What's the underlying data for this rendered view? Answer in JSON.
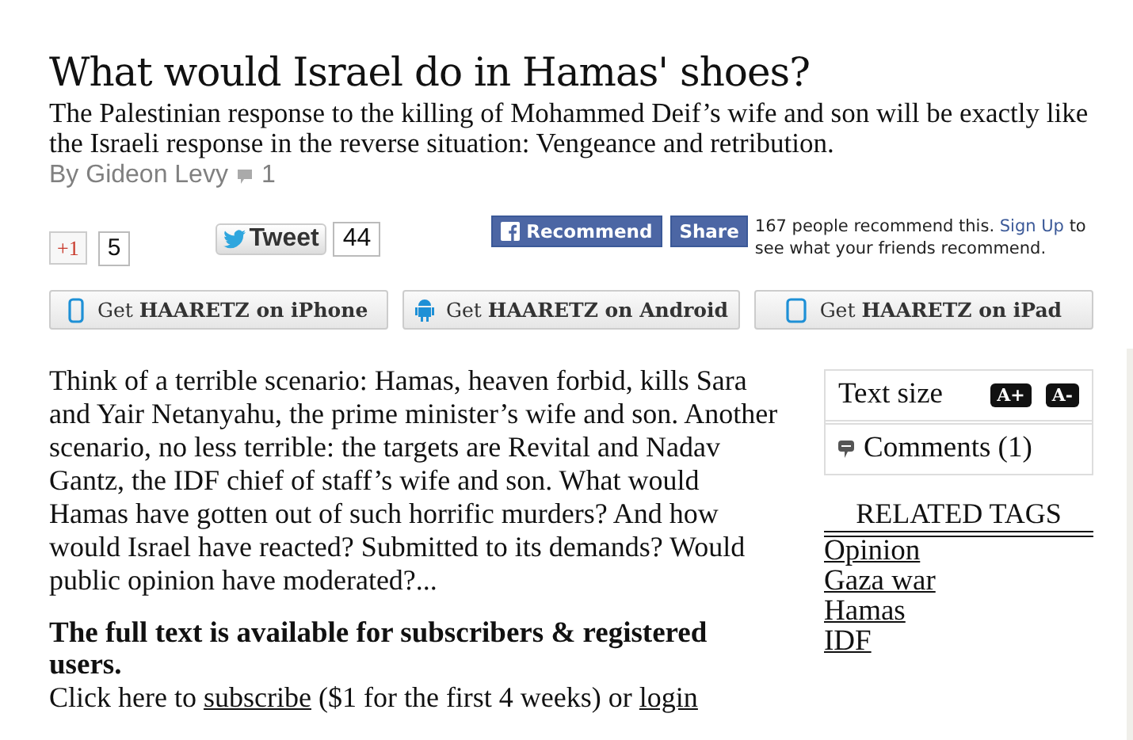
{
  "article": {
    "title": "What would Israel do in Hamas' shoes?",
    "subtitle": "The Palestinian response to the killing of Mohammed Deif’s wife and son will be exactly like the Israeli response in the reverse situation: Vengeance and retribution.",
    "byline": "By Gideon Levy",
    "comment_count": "1"
  },
  "social": {
    "gplus": {
      "label": "+1",
      "count": "5"
    },
    "tweet": {
      "label": "Tweet",
      "count": "44"
    },
    "recommend": "Recommend",
    "share": "Share",
    "fb_text_before": "167 people recommend this.",
    "fb_link": "Sign Up",
    "fb_text_after": "to see what your friends recommend."
  },
  "apps": [
    {
      "kind": "phone",
      "label": "Get **HAARETZ on iPhone**"
    },
    {
      "kind": "android",
      "label": "Get **HAARETZ on Android**"
    },
    {
      "kind": "tablet",
      "label": "Get **HAARETZ on iPad**"
    }
  ],
  "body": "Think of a terrible scenario: Hamas, heaven forbid, kills Sara and Yair Netanyahu, the prime minister’s wife and son. Another scenario, no less terrible: the targets are Revital and Nadav Gantz, the IDF chief of staff’s wife and son. What would Hamas have gotten out of such horrific murders? And how would Israel have reacted? Submitted to its demands? Would public opinion have moderated?...",
  "paywall": {
    "notice": "The full text is available for subscribers & registered users.",
    "before": "Click here to",
    "subscribe": "subscribe",
    "middle": "($1 for the first 4 weeks) or",
    "login": "login"
  },
  "sidebar": {
    "text_size_label": "Text size",
    "increase": "A+",
    "decrease": "A-",
    "comments": "Comments (1)",
    "tags_title": "RELATED TAGS",
    "tags": [
      "Opinion",
      "Gaza war",
      "Hamas",
      "IDF"
    ]
  }
}
